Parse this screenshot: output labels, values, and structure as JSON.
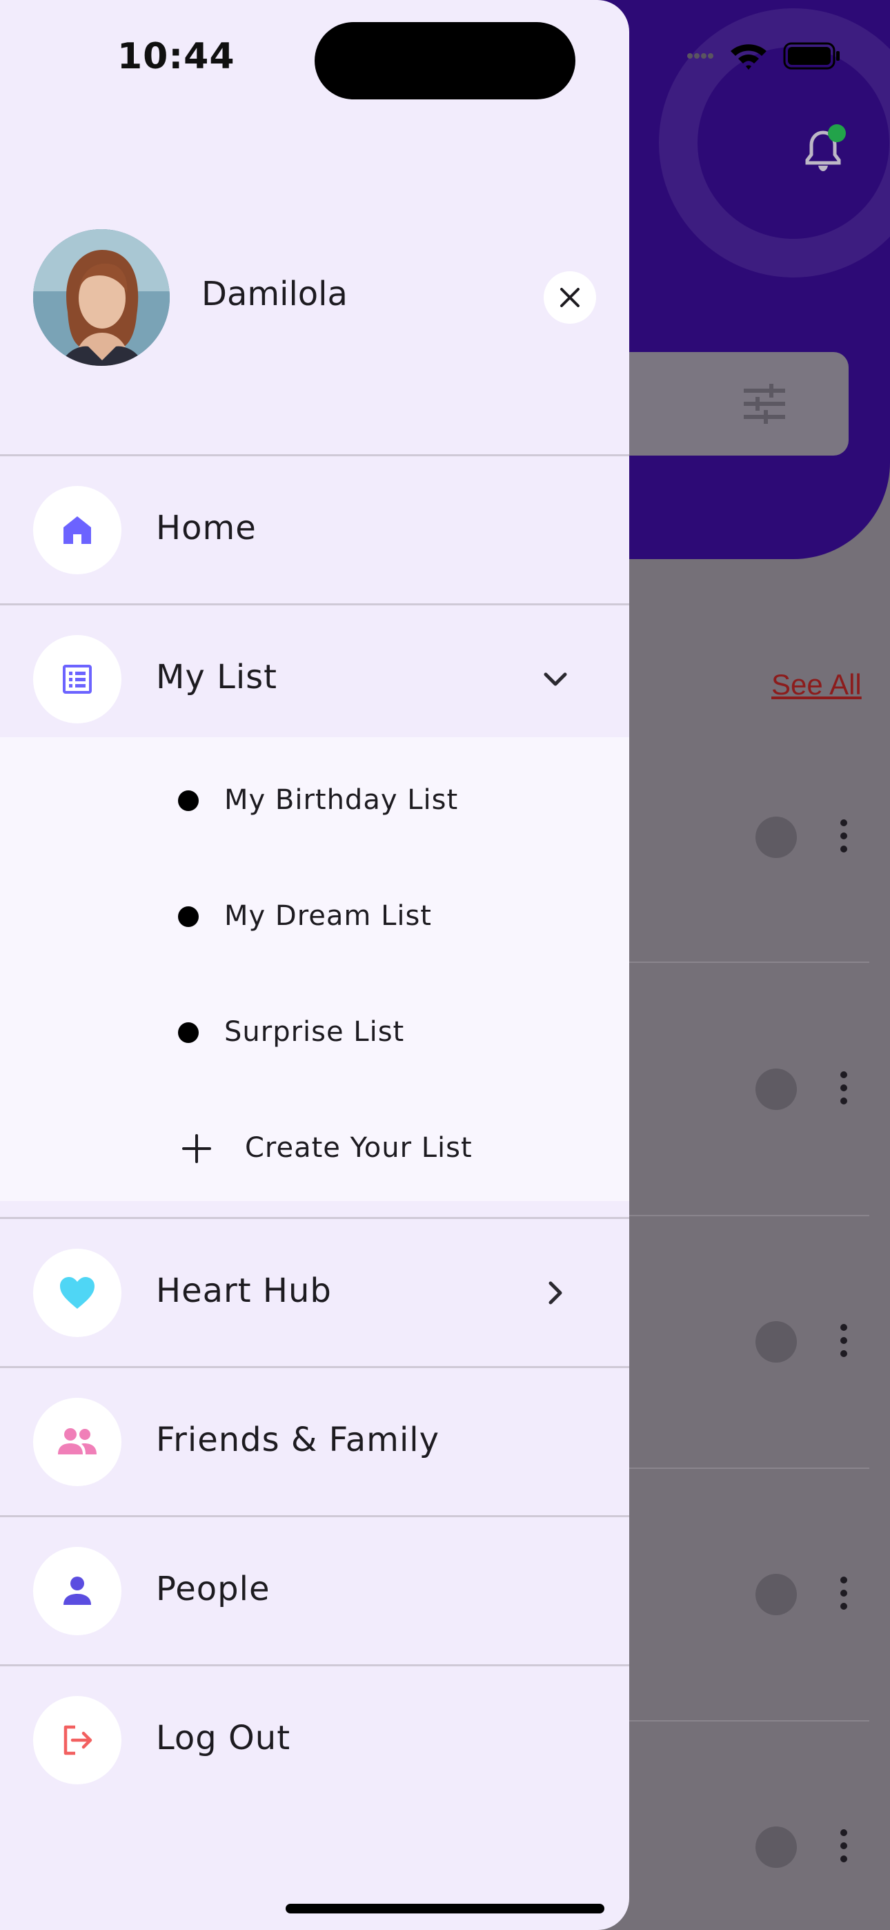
{
  "status_bar": {
    "time": "10:44"
  },
  "background": {
    "see_all_label": "See All"
  },
  "profile": {
    "name": "Damilola"
  },
  "menu": {
    "home": {
      "label": "Home",
      "icon": "home-icon",
      "icon_color": "#6c63ff"
    },
    "my_list": {
      "label": "My List",
      "icon": "list-icon",
      "icon_color": "#6c63ff",
      "expanded": true,
      "sub_items": [
        {
          "label": "My Birthday List"
        },
        {
          "label": "My Dream List"
        },
        {
          "label": "Surprise List"
        }
      ],
      "create_label": "Create Your List"
    },
    "heart_hub": {
      "label": "Heart Hub",
      "icon": "heart-icon",
      "icon_color": "#4fd6f5"
    },
    "friends_family": {
      "label": "Friends & Family",
      "icon": "group-icon",
      "icon_color": "#f07fb8"
    },
    "people": {
      "label": "People",
      "icon": "person-icon",
      "icon_color": "#5b4de0"
    },
    "logout": {
      "label": "Log Out",
      "icon": "logout-icon",
      "icon_color": "#f26060"
    }
  },
  "colors": {
    "drawer_bg": "#f2ecfc",
    "header_bg": "#2d0a76",
    "scrim": "#757078"
  }
}
